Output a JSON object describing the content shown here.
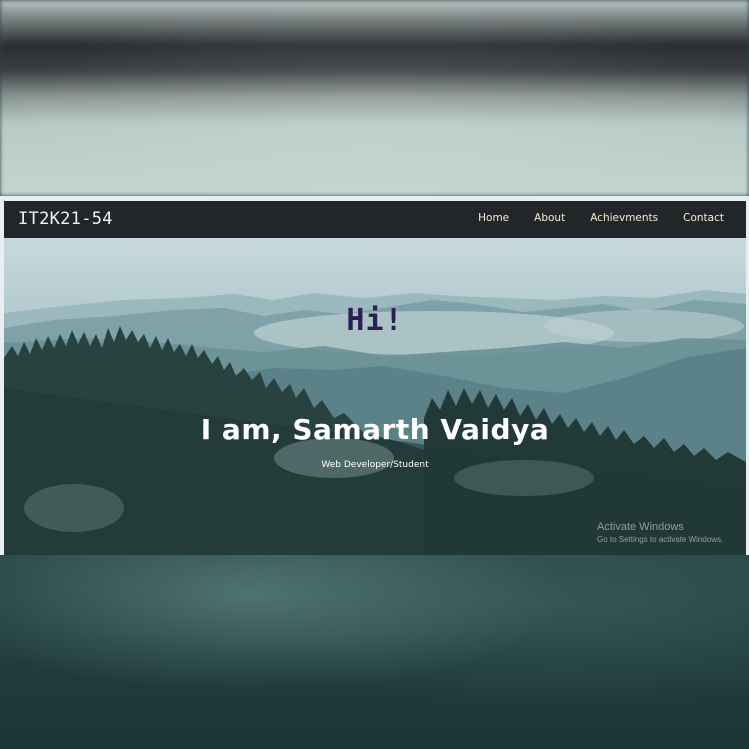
{
  "navbar": {
    "brand": "IT2K21-54",
    "links": [
      "Home",
      "About",
      "Achievments",
      "Contact"
    ]
  },
  "hero": {
    "greeting": "Hi!",
    "headline": "I am, Samarth Vaidya",
    "subtitle": "Web Developer/Student"
  },
  "os_watermark": {
    "title": "Activate Windows",
    "subtitle": "Go to Settings to activate Windows."
  },
  "colors": {
    "navbar_bg": "#232629",
    "nav_link": "#f6ecd0",
    "greeting": "#2c1f52",
    "headline": "#ffffff"
  }
}
